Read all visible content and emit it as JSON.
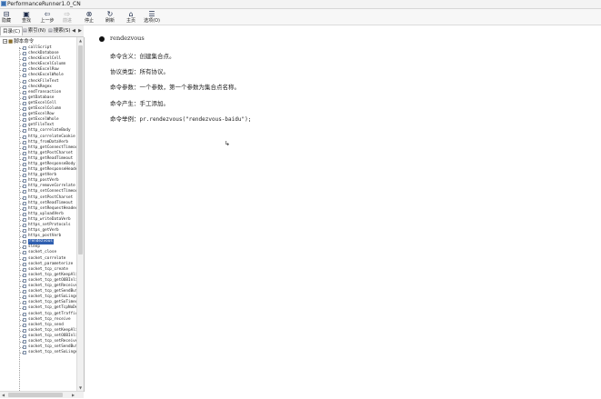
{
  "window": {
    "title": "PerformanceRunner1.0_CN"
  },
  "toolbar": {
    "buttons": [
      {
        "label": "隐藏",
        "icon": "hide-icon"
      },
      {
        "label": "查找",
        "icon": "search-icon"
      },
      {
        "label": "上一步",
        "icon": "back-icon"
      },
      {
        "label": "前进",
        "icon": "forward-icon"
      },
      {
        "label": "停止",
        "icon": "stop-icon"
      },
      {
        "label": "刷新",
        "icon": "refresh-icon"
      },
      {
        "label": "主页",
        "icon": "home-icon"
      },
      {
        "label": "选项(O)",
        "icon": "options-icon"
      }
    ]
  },
  "tabs": [
    {
      "label": "目录(C)"
    },
    {
      "label": "索引(N)"
    },
    {
      "label": "搜索(S)"
    }
  ],
  "tree": {
    "root_label": "脚本命令",
    "items": [
      "callScript",
      "checkDatabase",
      "checkExcelCell",
      "checkExcelColumn",
      "checkExcelRow",
      "checkExcelWhole",
      "checkFileText",
      "checkRegex",
      "endTransaction",
      "getDatabase",
      "getExcelCell",
      "getExcelColumn",
      "getExcelRow",
      "getExcelWhole",
      "getFileText",
      "http_correlateBody",
      "http_correlateCookie",
      "http_fromDataVerb",
      "http_getConnectTimeout",
      "http_getPostCharset",
      "http_getReadTimeout",
      "http_getResponseBody",
      "http_getResponseHeader",
      "http_getVerb",
      "http_postVerb",
      "http_removeCorrelate",
      "http_setConnectTimeout",
      "http_setPostCharset",
      "http_setReadTimeout",
      "http_setRequestHeader",
      "http_uploadVerb",
      "http_writeDataVerb",
      "https_setProtocols",
      "https_getVerb",
      "https_postVerb",
      "rendezvous",
      "sleep",
      "socket_close",
      "socket_correlate",
      "socket_parameterize",
      "socket_tcp_create",
      "socket_tcp_getKeepAlive",
      "socket_tcp_getOOBInline",
      "socket_tcp_getReceiveBuffer",
      "socket_tcp_getSendBuffer",
      "socket_tcp_getSoLinger",
      "socket_tcp_getSoTimeout",
      "socket_tcp_getTcpNoDelay",
      "socket_tcp_getTrafficClass",
      "socket_tcp_receive",
      "socket_tcp_send",
      "socket_tcp_setKeepAlive",
      "socket_tcp_setOOBInline",
      "socket_tcp_setReceiveBuffer",
      "socket_tcp_setSendBuffer",
      "socket_tcp_setSoLinger"
    ],
    "selected_index": 35
  },
  "content": {
    "command_name": "rendezvous",
    "meaning": "命令含义：创建集合点。",
    "protocol": "协议类型：所有协议。",
    "params": "命令参数：一个参数，第一个参数为集合点名称。",
    "origin": "命令产生：手工添加。",
    "example_label": "命令举例：",
    "example_code": "pr.rendezvous(\"rendezvous-baidu\");"
  }
}
